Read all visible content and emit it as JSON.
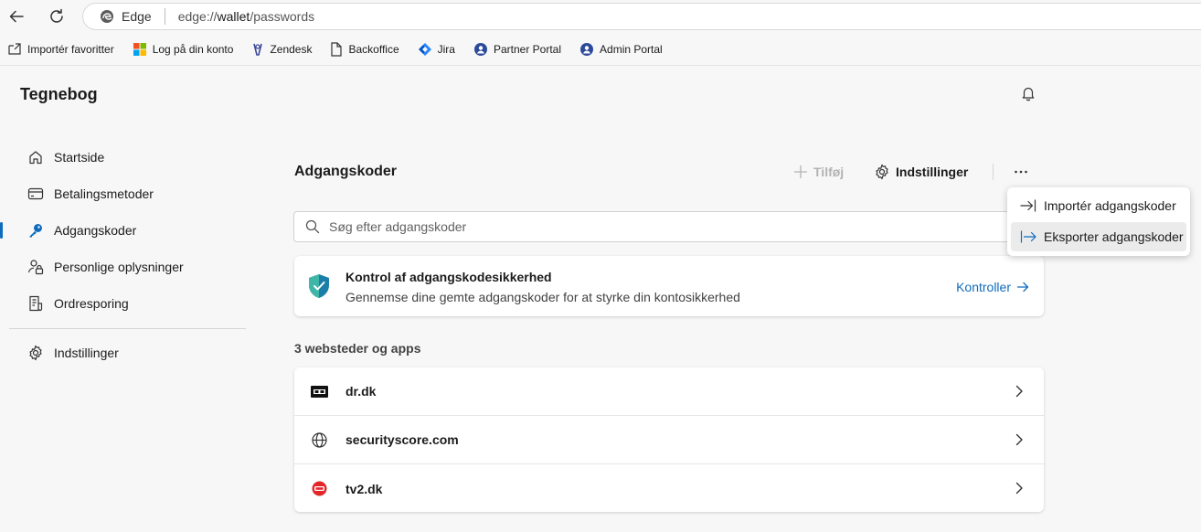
{
  "browser": {
    "brand_label": "Edge",
    "url_prefix": "edge://",
    "url_host": "wallet",
    "url_path": "/passwords"
  },
  "bookmarks": [
    {
      "label": "Importér favoritter",
      "icon": "import-favorites-icon"
    },
    {
      "label": "Log på din konto",
      "icon": "microsoft-logo-icon"
    },
    {
      "label": "Zendesk",
      "icon": "zendesk-icon"
    },
    {
      "label": "Backoffice",
      "icon": "page-icon"
    },
    {
      "label": "Jira",
      "icon": "jira-icon"
    },
    {
      "label": "Partner Portal",
      "icon": "portal-icon"
    },
    {
      "label": "Admin Portal",
      "icon": "portal-icon"
    }
  ],
  "page": {
    "title": "Tegnebog"
  },
  "sidebar": {
    "items": [
      {
        "label": "Startside",
        "icon": "home-icon"
      },
      {
        "label": "Betalingsmetoder",
        "icon": "card-icon"
      },
      {
        "label": "Adgangskoder",
        "icon": "key-icon",
        "active": true
      },
      {
        "label": "Personlige oplysninger",
        "icon": "person-lock-icon"
      },
      {
        "label": "Ordresporing",
        "icon": "receipt-icon"
      }
    ],
    "settings_label": "Indstillinger"
  },
  "main": {
    "section_title": "Adgangskoder",
    "add_label": "Tilføj",
    "settings_label": "Indstillinger",
    "search_placeholder": "Søg efter adgangskoder",
    "check": {
      "title": "Kontrol af adgangskodesikkerhed",
      "description": "Gennemse dine gemte adgangskoder for at styrke din kontosikkerhed",
      "link_label": "Kontroller"
    },
    "sites_label": "3 websteder og apps",
    "sites": [
      {
        "name": "dr.dk",
        "icon": "dr-logo-icon"
      },
      {
        "name": "securityscore.com",
        "icon": "globe-icon"
      },
      {
        "name": "tv2.dk",
        "icon": "tv2-logo-icon"
      }
    ]
  },
  "menu": {
    "items": [
      {
        "label": "Importér adgangskoder",
        "icon": "import-icon"
      },
      {
        "label": "Eksporter adgangskoder",
        "icon": "export-icon",
        "hovered": true
      }
    ]
  },
  "colors": {
    "accent": "#0f6cbd",
    "background": "#f7f7f7",
    "card": "#ffffff"
  }
}
